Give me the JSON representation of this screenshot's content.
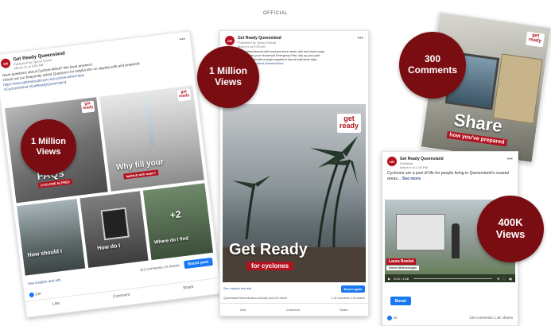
{
  "header": {
    "title": "OFFICIAL"
  },
  "card1": {
    "page_name": "Get Ready Queensland",
    "published_by": "Published by Sprout Social",
    "post_date": "March 11 at 9:00 AM",
    "text_line1": "Have questions about Cyclone Alfred? We have answers!",
    "text_line2": "Check out our frequently asked Questions for helpful info on staying safe and prepared.",
    "link": "https://www.getready.qld.gov.au/cyclone-alfred-faqs",
    "hashtags": "#CycloneAlfred #GetReadyQueensland",
    "tiles": {
      "faqs": "FAQs",
      "faqs_sub": "CYCLONE ALFRED",
      "fill": "Why fill your",
      "fill_sub": "bathtub with water?",
      "shouldi": "How should I",
      "howdoi": "How do I",
      "whereisit": "Where do I find",
      "more": "+2"
    },
    "boost": "Boost post",
    "insights": "See insights and ads",
    "stats": "113 comments   14 shares",
    "reactions": "23K",
    "actions": [
      "Like",
      "Comment",
      "Share"
    ]
  },
  "card2": {
    "page_name": "Get Ready Queensland",
    "published_by": "Published by Sprout Social",
    "post_date": "March 6 at 9:00 AM",
    "text_line1": "Cyclones are powerful storms with hurricane-force winds, rain and storm surge.",
    "text_line2": "Get ready now - review your Household Emergency Plan, tidy up your yard.",
    "text_line3": "Keep your emergency kit with enough supplies to last at least three days.",
    "hashtags": "#GetReadyQld #CycloneAlfred #WeatherWise",
    "headline": "Get Ready",
    "headline_sub": "for cyclones",
    "insights": "See insights and ads",
    "boost": "Boost again",
    "stats": "2.1K comments   2.4K shares",
    "reactions": "Queensland Reconstruction Authority and 14K others",
    "actions": [
      "Like",
      "Comment",
      "Share"
    ]
  },
  "card3": {
    "title": "Share",
    "subtitle": "how you've prepared"
  },
  "card4": {
    "page_name": "Get Ready Queensland",
    "published_by": "Publisher",
    "post_date": "March 9 at 1:00 PM",
    "text": "Cyclones are a part of life for people living in Queensland's coastal areas...",
    "see_more": "See more",
    "speaker_name": "Laura Boekel",
    "speaker_title": "Senior Meteorologist",
    "video_time": "0:00 / 1:58",
    "boost": "Boost",
    "stats": "109 comments   1.3K shares",
    "reactions": "1K"
  },
  "badges": {
    "b1": "1 Million Views",
    "b2": "1 Million Views",
    "b3": "300 Comments",
    "b4": "400K Views"
  },
  "logo": {
    "line1": "get",
    "line2": "ready"
  },
  "colors": {
    "brand_red": "#b2131f",
    "badge_red": "#7a0d12",
    "facebook_blue": "#1877f2"
  }
}
